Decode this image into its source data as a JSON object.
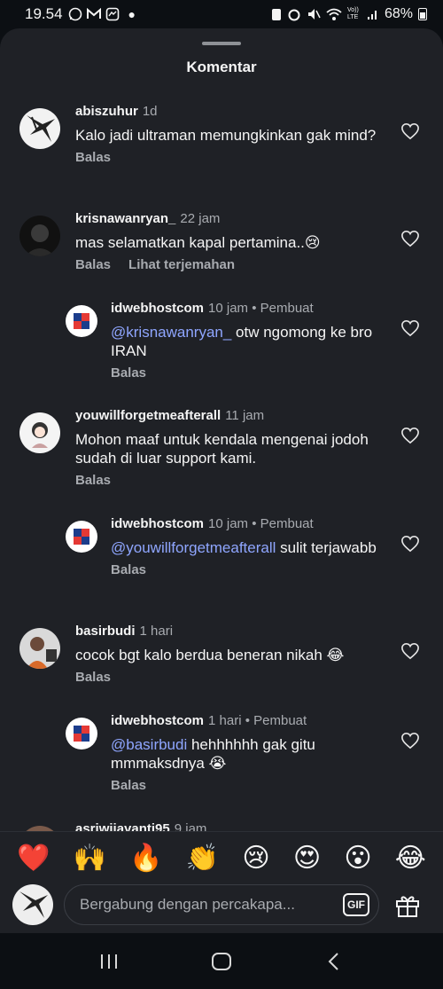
{
  "status_bar": {
    "time": "19.54",
    "notifications": [
      "whatsapp-icon",
      "gmail-icon",
      "messenger-icon",
      "dot"
    ],
    "battery": "68%",
    "vol_lte": "Vo)) LTE"
  },
  "sheet": {
    "title": "Komentar"
  },
  "comments": [
    {
      "user": "abiszuhur",
      "time": "1d",
      "badge": "",
      "text": "Kalo jadi ultraman memungkinkan gak mind?",
      "mention": "",
      "actions": [
        "Balas"
      ],
      "is_reply": false
    },
    {
      "user": "krisnawanryan_",
      "time": "22 jam",
      "badge": "",
      "text": "mas selamatkan kapal pertamina..😢",
      "mention": "",
      "actions": [
        "Balas",
        "Lihat terjemahan"
      ],
      "is_reply": false
    },
    {
      "user": "idwebhostcom",
      "time": "10 jam",
      "badge": "• Pembuat",
      "mention": "@krisnawanryan_",
      "text": " otw ngomong ke bro IRAN",
      "actions": [
        "Balas"
      ],
      "is_reply": true
    },
    {
      "user": "youwillforgetmeafterall",
      "time": "11 jam",
      "badge": "",
      "text": "Mohon maaf untuk kendala mengenai jodoh sudah di luar support kami.",
      "mention": "",
      "actions": [
        "Balas"
      ],
      "is_reply": false
    },
    {
      "user": "idwebhostcom",
      "time": "10 jam",
      "badge": "• Pembuat",
      "mention": "@youwillforgetmeafterall",
      "text": " sulit terjawabb",
      "actions": [
        "Balas"
      ],
      "is_reply": true
    },
    {
      "user": "basirbudi",
      "time": "1 hari",
      "badge": "",
      "text": "cocok bgt kalo berdua beneran nikah 😂",
      "mention": "",
      "actions": [
        "Balas"
      ],
      "is_reply": false
    },
    {
      "user": "idwebhostcom",
      "time": "1 hari",
      "badge": "• Pembuat",
      "mention": "@basirbudi",
      "text": " hehhhhhh gak gitu mmmaksdnya 😭",
      "actions": [
        "Balas"
      ],
      "is_reply": true
    },
    {
      "user": "asriwijayanti95",
      "time": "9 jam",
      "badge": "",
      "text": "",
      "mention": "",
      "actions": [],
      "is_reply": false
    }
  ],
  "emoji_bar": [
    "❤️",
    "🙌",
    "🔥",
    "👏",
    "😢",
    "😍",
    "😮",
    "😂"
  ],
  "input": {
    "placeholder": "Bergabung dengan percakapa...",
    "gif_label": "GIF"
  },
  "colors": {
    "background": "#1f2126",
    "mention": "#8fa6ff",
    "muted": "#a8abb0"
  }
}
